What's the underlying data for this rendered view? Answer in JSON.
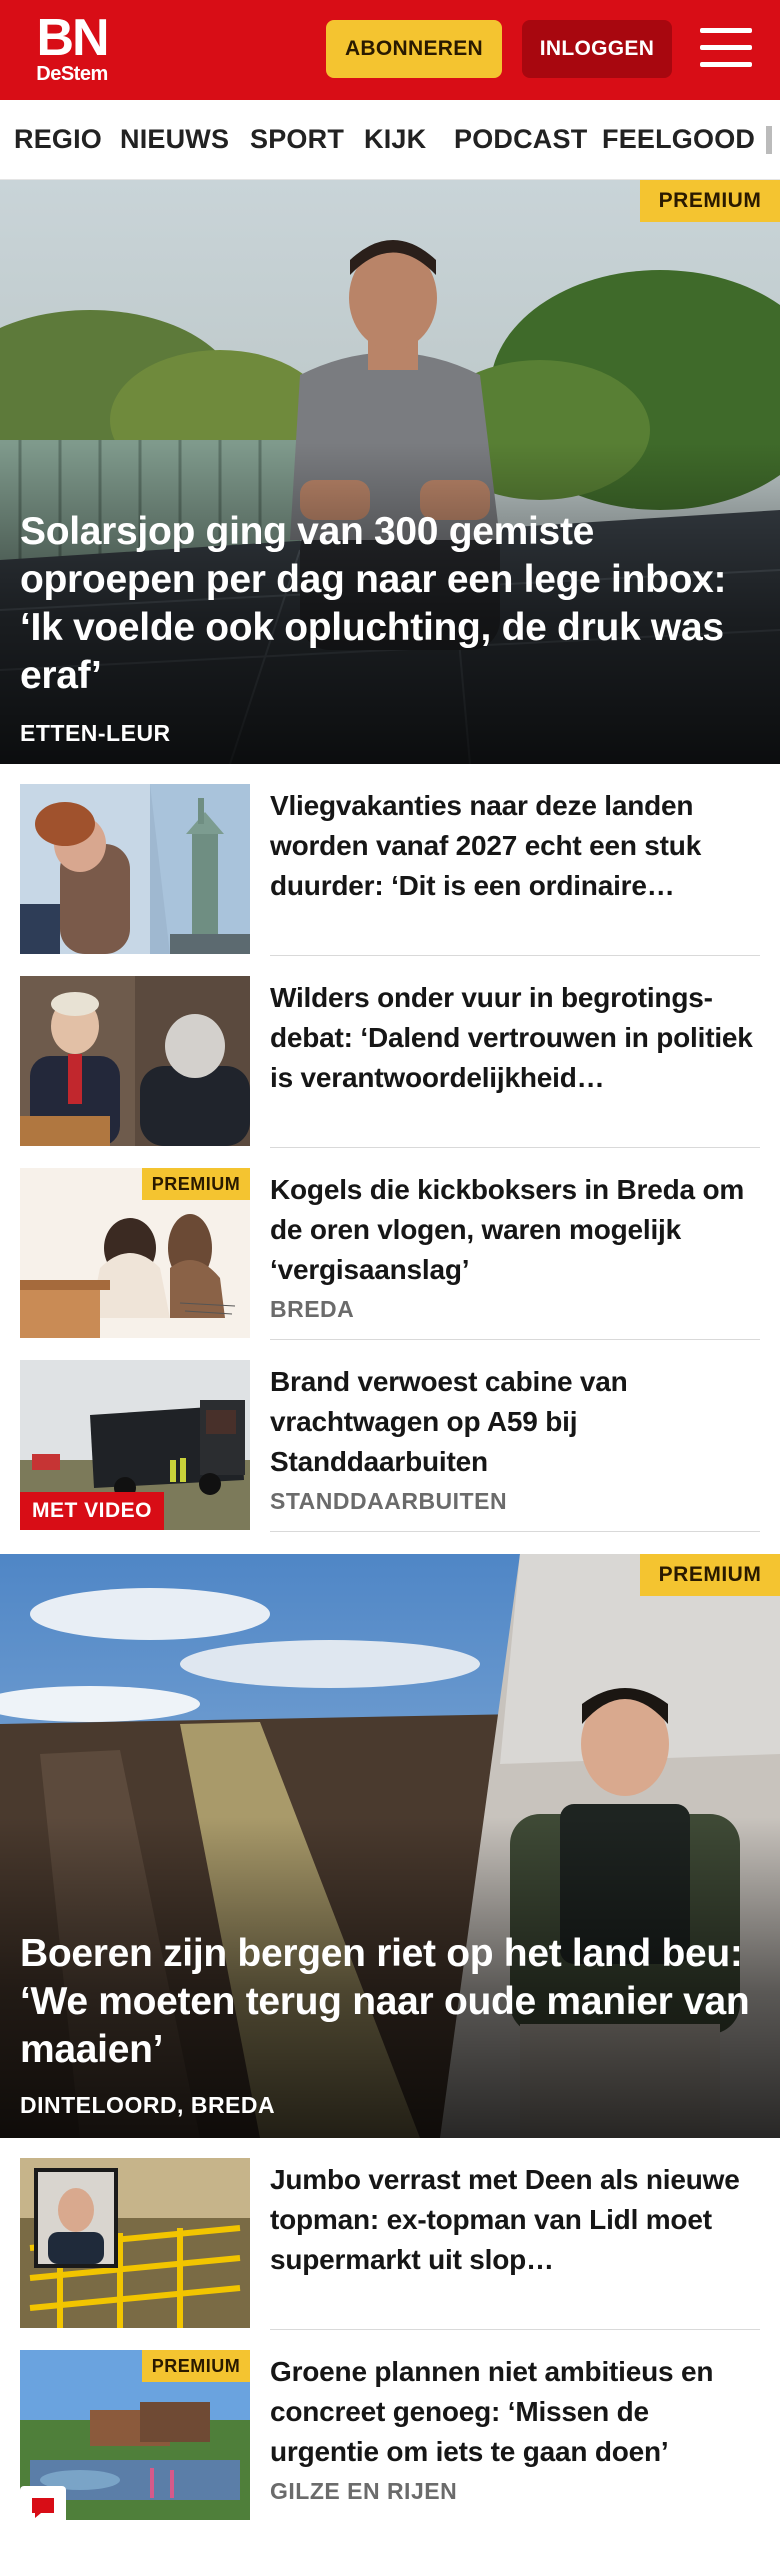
{
  "header": {
    "logo_main": "BN",
    "logo_sub": "DeStem",
    "subscribe_label": "ABONNEREN",
    "login_label": "INLOGGEN",
    "menu_icon": "hamburger-icon",
    "brand_color": "#d80d16",
    "accent_color": "#f4c430"
  },
  "nav": {
    "items": [
      "REGIO",
      "NIEUWS",
      "SPORT",
      "KIJK",
      "PODCAST",
      "FEELGOOD"
    ]
  },
  "articles": {
    "hero1": {
      "badge": "PREMIUM",
      "title": "Solarsjop ging van 300 gemiste oproepen per dag naar een lege inbox: ‘Ik voelde ook opluchting, de druk was eraf’",
      "location": "ETTEN-LEUR"
    },
    "item1": {
      "title": "Vliegvakanties naar deze landen worden vanaf 2027 echt een stuk duurder: ‘Dit is een ordinaire…"
    },
    "item2": {
      "title": "Wilders onder vuur in begrotings­debat: ‘Dalend vertrouwen in politiek is verantwoordelijkheid…"
    },
    "item3": {
      "badge": "PREMIUM",
      "title": "Kogels die kickboksers in Breda om de oren vlogen, waren mogelijk ‘vergisaanslag’",
      "location": "BREDA"
    },
    "item4": {
      "video_label": "MET VIDEO",
      "title": "Brand verwoest cabine van vrachtwagen op A59 bij Standdaarbuiten",
      "location": "STANDDAARBUITEN"
    },
    "hero2": {
      "badge": "PREMIUM",
      "title": "Boeren zijn bergen riet op het land beu: ‘We moeten terug naar oude manier van maaien’",
      "location": "DINTELOORD, BREDA"
    },
    "item5": {
      "title": "Jumbo verrast met Deen als nieuwe topman: ex-topman van Lidl moet supermarkt uit slop…"
    },
    "item6": {
      "badge": "PREMIUM",
      "title": "Groene plannen niet ambitieus en concreet genoeg: ‘Missen de urgentie om iets te gaan doen’",
      "location": "GILZE EN RIJEN"
    }
  },
  "widgets": {
    "chat_icon": "chat-bubble-icon"
  }
}
